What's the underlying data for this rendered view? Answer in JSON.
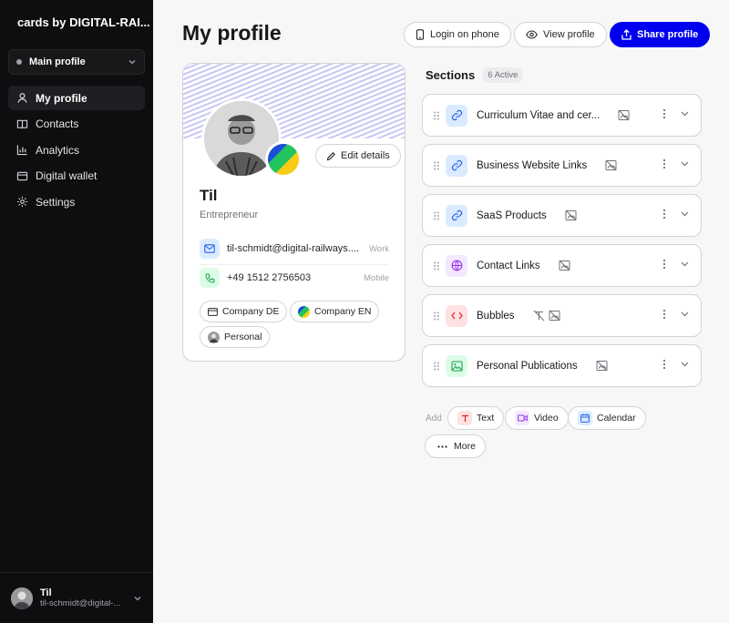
{
  "sidebar": {
    "brand": "cards by DIGITAL-RAI...",
    "profile_select": "Main profile",
    "nav": [
      {
        "label": "My profile",
        "icon": "user-icon",
        "active": true
      },
      {
        "label": "Contacts",
        "icon": "book-icon"
      },
      {
        "label": "Analytics",
        "icon": "bar-chart-icon"
      },
      {
        "label": "Digital wallet",
        "icon": "wallet-icon"
      },
      {
        "label": "Settings",
        "icon": "gear-icon"
      }
    ],
    "user": {
      "name": "Til",
      "email": "til-schmidt@digital-..."
    }
  },
  "header": {
    "title": "My profile",
    "login_phone": "Login on phone",
    "view_profile": "View profile",
    "share_profile": "Share profile"
  },
  "card": {
    "edit_details": "Edit details",
    "name": "Til",
    "role": "Entrepreneur",
    "email": "til-schmidt@digital-railways....",
    "email_tag": "Work",
    "phone": "+49 1512 2756503",
    "phone_tag": "Mobile",
    "chips": [
      "Company DE",
      "Company EN",
      "Personal"
    ]
  },
  "sections": {
    "title": "Sections",
    "count": "6 Active",
    "items": [
      {
        "label": "Curriculum Vitae and cer...",
        "icon": "link-icon"
      },
      {
        "label": "Business Website Links",
        "icon": "link-icon"
      },
      {
        "label": "SaaS Products",
        "icon": "link-icon"
      },
      {
        "label": "Contact Links",
        "icon": "globe-icon"
      },
      {
        "label": "Bubbles",
        "icon": "code-icon"
      },
      {
        "label": "Personal Publications",
        "icon": "image-icon"
      }
    ]
  },
  "add": {
    "label": "Add",
    "text": "Text",
    "video": "Video",
    "calendar": "Calendar",
    "more": "More"
  },
  "colors": {
    "accent": "#0000ee",
    "sidebar_bg": "#0e0e10"
  }
}
